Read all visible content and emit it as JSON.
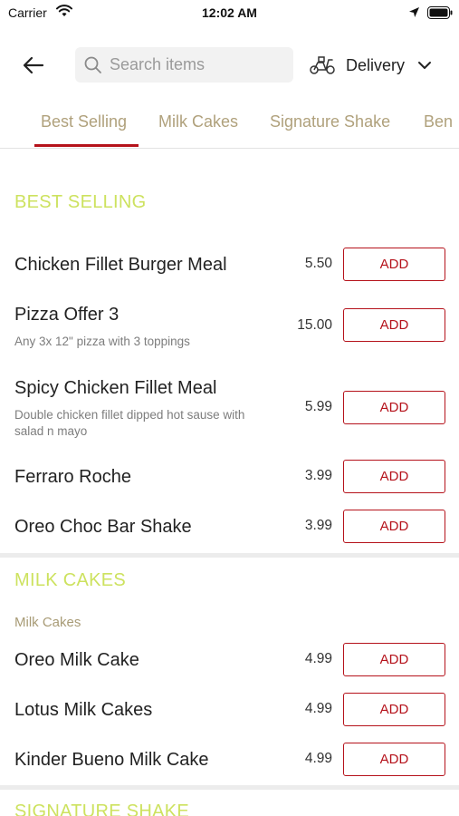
{
  "status_bar": {
    "carrier": "Carrier",
    "time": "12:02 AM"
  },
  "header": {
    "search_placeholder": "Search items",
    "delivery_label": "Delivery"
  },
  "tabs": [
    {
      "label": "Best Selling"
    },
    {
      "label": "Milk Cakes"
    },
    {
      "label": "Signature Shake"
    },
    {
      "label": "Ben"
    }
  ],
  "sections": [
    {
      "title": "BEST SELLING",
      "items": [
        {
          "name": "Chicken Fillet Burger Meal",
          "desc": "",
          "price": "5.50",
          "add_label": "ADD"
        },
        {
          "name": "Pizza Offer 3",
          "desc": "Any 3x 12\" pizza with 3 toppings",
          "price": "15.00",
          "add_label": "ADD"
        },
        {
          "name": "Spicy Chicken Fillet Meal",
          "desc": "Double chicken fillet dipped hot sause with salad n mayo",
          "price": "5.99",
          "add_label": "ADD"
        },
        {
          "name": "Ferraro Roche",
          "desc": "",
          "price": "3.99",
          "add_label": "ADD"
        },
        {
          "name": "Oreo Choc Bar Shake",
          "desc": "",
          "price": "3.99",
          "add_label": "ADD"
        }
      ]
    },
    {
      "title": "MILK CAKES",
      "subtitle": "Milk Cakes",
      "items": [
        {
          "name": "Oreo Milk Cake",
          "price": "4.99",
          "add_label": "ADD"
        },
        {
          "name": "Lotus Milk Cakes",
          "price": "4.99",
          "add_label": "ADD"
        },
        {
          "name": "Kinder Bueno Milk Cake",
          "price": "4.99",
          "add_label": "ADD"
        }
      ]
    },
    {
      "title": "SIGNATURE SHAKE"
    }
  ],
  "colors": {
    "accent_red": "#b5121b",
    "section_title": "#cde25f",
    "tab_text": "#b0a17c"
  }
}
